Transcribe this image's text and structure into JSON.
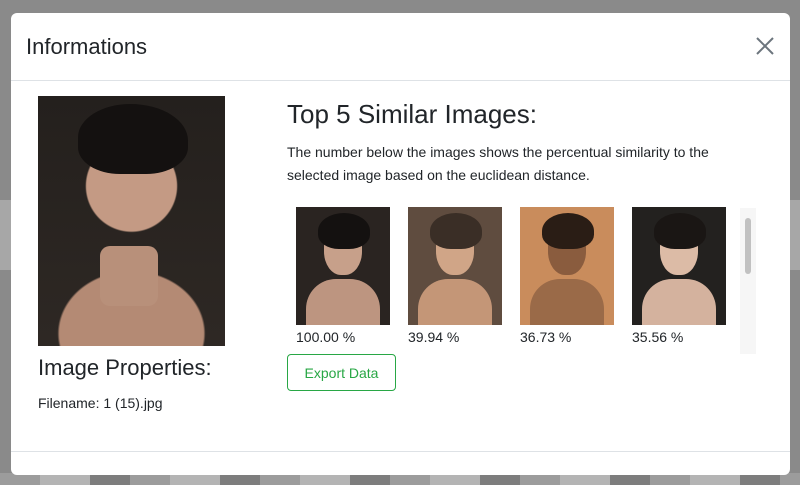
{
  "modal": {
    "title": "Informations"
  },
  "left_panel": {
    "properties_heading": "Image Properties:",
    "filename_label": "Filename:",
    "filename_value": "1 (15).jpg"
  },
  "similar": {
    "heading": "Top 5 Similar Images:",
    "description": "The number below the images shows the percentual similarity to the selected image based on the euclidean distance.",
    "results": [
      {
        "similarity": "100.00 %"
      },
      {
        "similarity": "39.94 %"
      },
      {
        "similarity": "36.73 %"
      },
      {
        "similarity": "35.56 %"
      }
    ],
    "export_label": "Export Data"
  },
  "colors": {
    "accent_success": "#28a745",
    "border": "#dee2e6",
    "overlay": "#8a8a8a"
  },
  "icons": {
    "close": "close-icon"
  }
}
